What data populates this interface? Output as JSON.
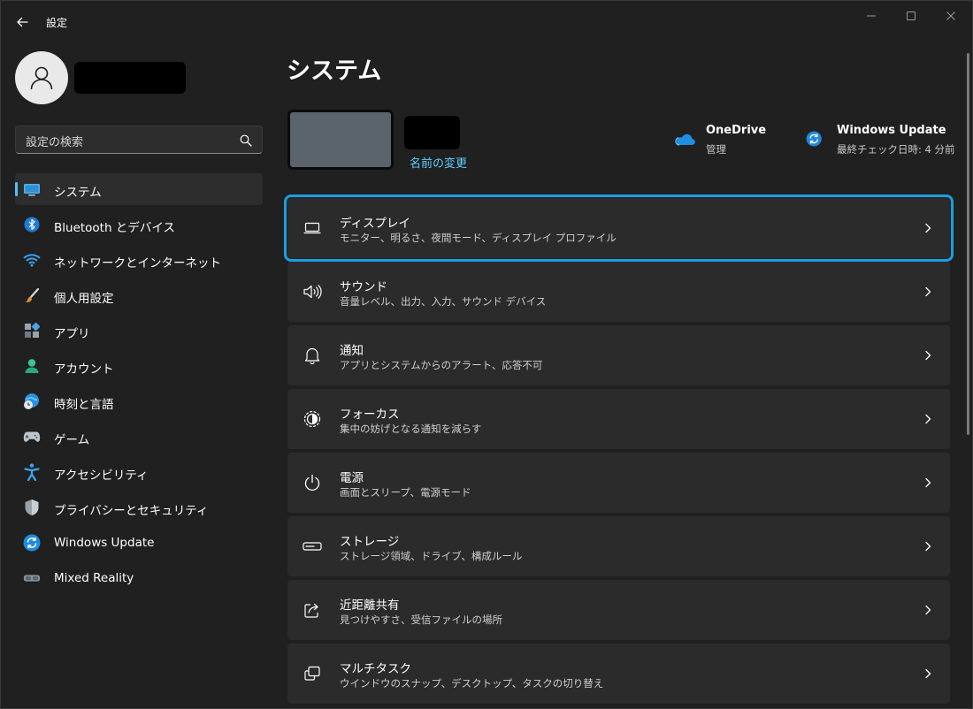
{
  "window": {
    "title": "設定",
    "controls": {
      "minimize": "minimize-icon",
      "maximize": "maximize-icon",
      "close": "close-icon"
    }
  },
  "sidebar": {
    "search_placeholder": "設定の検索",
    "items": [
      {
        "label": "システム",
        "icon": "system-display-icon",
        "active": true
      },
      {
        "label": "Bluetooth とデバイス",
        "icon": "bluetooth-icon"
      },
      {
        "label": "ネットワークとインターネット",
        "icon": "wifi-icon"
      },
      {
        "label": "個人用設定",
        "icon": "brush-icon"
      },
      {
        "label": "アプリ",
        "icon": "apps-icon"
      },
      {
        "label": "アカウント",
        "icon": "account-icon"
      },
      {
        "label": "時刻と言語",
        "icon": "globe-clock-icon"
      },
      {
        "label": "ゲーム",
        "icon": "gamepad-icon"
      },
      {
        "label": "アクセシビリティ",
        "icon": "accessibility-icon"
      },
      {
        "label": "プライバシーとセキュリティ",
        "icon": "shield-icon"
      },
      {
        "label": "Windows Update",
        "icon": "windows-update-icon"
      },
      {
        "label": "Mixed Reality",
        "icon": "mixed-reality-icon"
      }
    ]
  },
  "main": {
    "title": "システム",
    "rename_link": "名前の変更",
    "quick_links": [
      {
        "title": "OneDrive",
        "subtitle": "管理",
        "icon": "onedrive-cloud-icon"
      },
      {
        "title": "Windows Update",
        "subtitle": "最終チェック日時: 4 分前",
        "icon": "windows-update-icon"
      }
    ],
    "cards": [
      {
        "title": "ディスプレイ",
        "subtitle": "モニター、明るさ、夜間モード、ディスプレイ プロファイル",
        "icon": "display-icon",
        "highlighted": true
      },
      {
        "title": "サウンド",
        "subtitle": "音量レベル、出力、入力、サウンド デバイス",
        "icon": "speaker-icon"
      },
      {
        "title": "通知",
        "subtitle": "アプリとシステムからのアラート、応答不可",
        "icon": "bell-icon"
      },
      {
        "title": "フォーカス",
        "subtitle": "集中の妨げとなる通知を減らす",
        "icon": "focus-icon"
      },
      {
        "title": "電源",
        "subtitle": "画面とスリープ、電源モード",
        "icon": "power-icon"
      },
      {
        "title": "ストレージ",
        "subtitle": "ストレージ領域、ドライブ、構成ルール",
        "icon": "storage-icon"
      },
      {
        "title": "近距離共有",
        "subtitle": "見つけやすさ、受信ファイルの場所",
        "icon": "share-icon"
      },
      {
        "title": "マルチタスク",
        "subtitle": "ウインドウのスナップ、デスクトップ、タスクの切り替え",
        "icon": "multitask-icon"
      }
    ]
  },
  "colors": {
    "background": "#202020",
    "card": "#2b2b2b",
    "accent": "#4cc2ff",
    "link": "#60cdff",
    "highlight_outline": "#1a9ee2"
  }
}
